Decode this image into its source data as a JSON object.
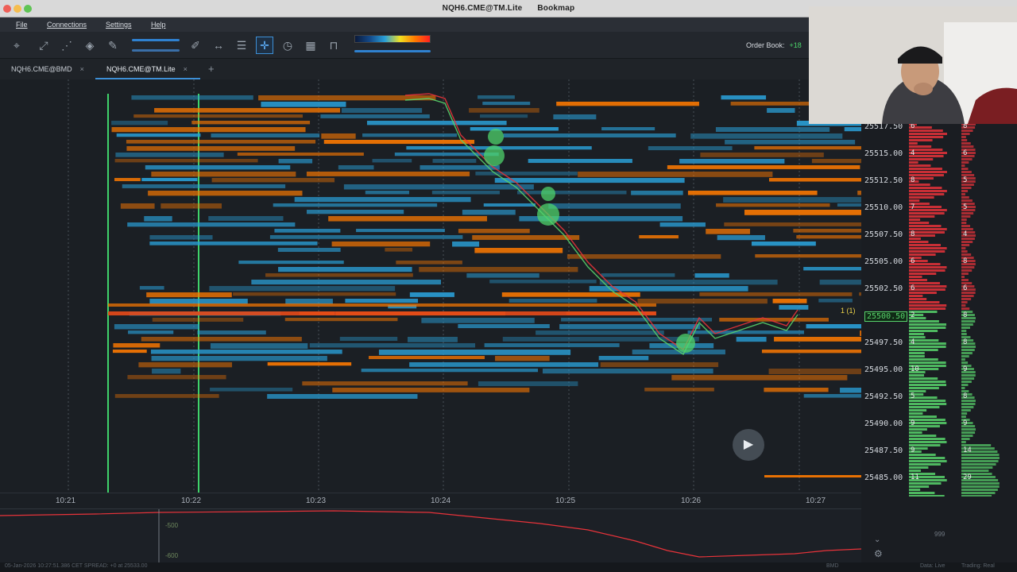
{
  "window": {
    "title_left": "NQH6.CME@TM.Lite",
    "title_right": "Bookmap"
  },
  "menu": {
    "file": "File",
    "connections": "Connections",
    "settings": "Settings",
    "help": "Help"
  },
  "toolbar": {
    "order_book_label": "Order Book:",
    "order_book_value": "+18"
  },
  "tabs": [
    {
      "label": "NQH6.CME@BMD",
      "close": "×"
    },
    {
      "label": "NQH6.CME@TM.Lite",
      "close": "×"
    }
  ],
  "tab_add": "+",
  "time_axis": [
    "10:21",
    "10:22",
    "10:23",
    "10:24",
    "10:25",
    "10:26",
    "10:27"
  ],
  "price_ladder": [
    {
      "price": "25517.50",
      "bid": "6",
      "ask": "8"
    },
    {
      "price": "25515.00",
      "bid": "4",
      "ask": "6"
    },
    {
      "price": "25512.50",
      "bid": "8",
      "ask": "5"
    },
    {
      "price": "25510.00",
      "bid": "7",
      "ask": "5"
    },
    {
      "price": "25507.50",
      "bid": "8",
      "ask": "4"
    },
    {
      "price": "25505.00",
      "bid": "6",
      "ask": "8"
    },
    {
      "price": "25502.50",
      "bid": "6",
      "ask": "6"
    },
    {
      "price": "25500.50",
      "bid": "2",
      "ask": "8"
    },
    {
      "price": "25497.50",
      "bid": "4",
      "ask": "8"
    },
    {
      "price": "25495.00",
      "bid": "10",
      "ask": "9"
    },
    {
      "price": "25492.50",
      "bid": "5",
      "ask": "8"
    },
    {
      "price": "25490.00",
      "bid": "9",
      "ask": "9"
    },
    {
      "price": "25487.50",
      "bid": "9",
      "ask": "14"
    },
    {
      "price": "25485.00",
      "bid": "11",
      "ask": "29"
    }
  ],
  "current_price": "25500.50",
  "position_marker": "1 (1)",
  "indicator": {
    "level_top": "-500",
    "level_bottom": "-600"
  },
  "status_bar": {
    "left": "05-Jan-2026 10:27:51.386 CET   SPREAD: +0 at 25533.00",
    "right_a": "BMD",
    "right_b": "Data: Live",
    "right_c": "Trading: Real"
  },
  "overlay_counter": "999",
  "colors": {
    "bg": "#1b1f24",
    "bid": "#2aa0d8",
    "ask": "#ff7a00",
    "buy": "#58d36b",
    "sell": "#e8333a",
    "accent": "#3d8fd6"
  },
  "icons": [
    "crosshair-icon",
    "share-icon",
    "chart-icon",
    "settings-diamond-icon",
    "pencil-icon",
    "ruler-icon",
    "comment-icon",
    "cursor-icon",
    "clock-icon",
    "heatmap-icon",
    "lock-icon",
    "play-icon"
  ]
}
